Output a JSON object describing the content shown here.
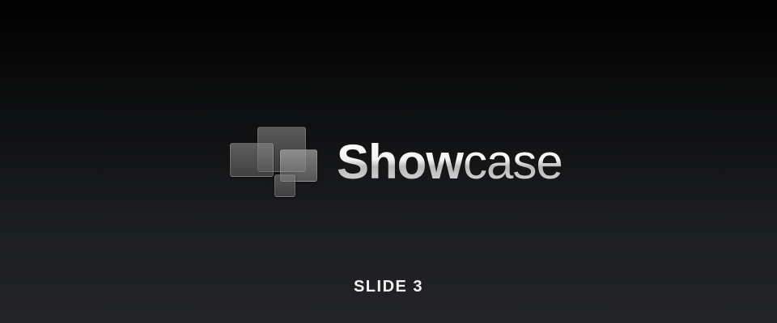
{
  "brand": {
    "name_bold": "Show",
    "name_light": "case",
    "logo_icon": "overlapping-tiles-icon"
  },
  "slide": {
    "label": "SLIDE 3"
  },
  "colors": {
    "background_top": "#010101",
    "background_bottom": "#232427",
    "text": "#f2f2f2"
  }
}
